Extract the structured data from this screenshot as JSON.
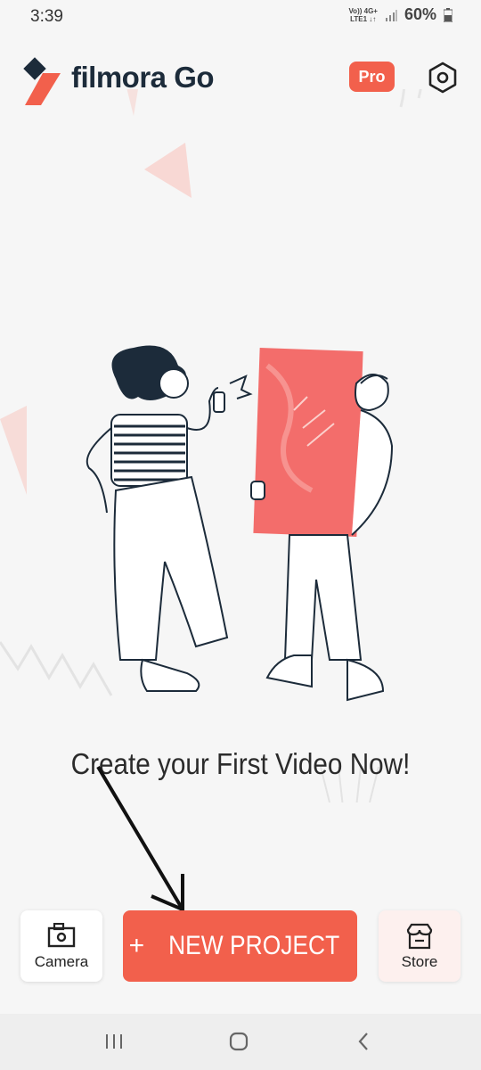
{
  "status_bar": {
    "time": "3:39",
    "network_line1": "Vo)) 4G+",
    "network_line2": "LTE1 ↓↑",
    "battery": "60%"
  },
  "header": {
    "app_title": "filmora Go",
    "pro_label": "Pro",
    "settings_icon": "settings-hexagon-icon"
  },
  "main": {
    "headline": "Create your First Video Now!"
  },
  "bottom_actions": {
    "camera_label": "Camera",
    "new_project_plus": "+",
    "new_project_label": "NEW PROJECT",
    "store_label": "Store"
  },
  "nav_bar": {
    "items": [
      "recent-apps-icon",
      "home-icon",
      "back-icon"
    ]
  },
  "colors": {
    "accent": "#f2604c",
    "navy": "#1c2b3a",
    "background": "#f6f6f6"
  }
}
